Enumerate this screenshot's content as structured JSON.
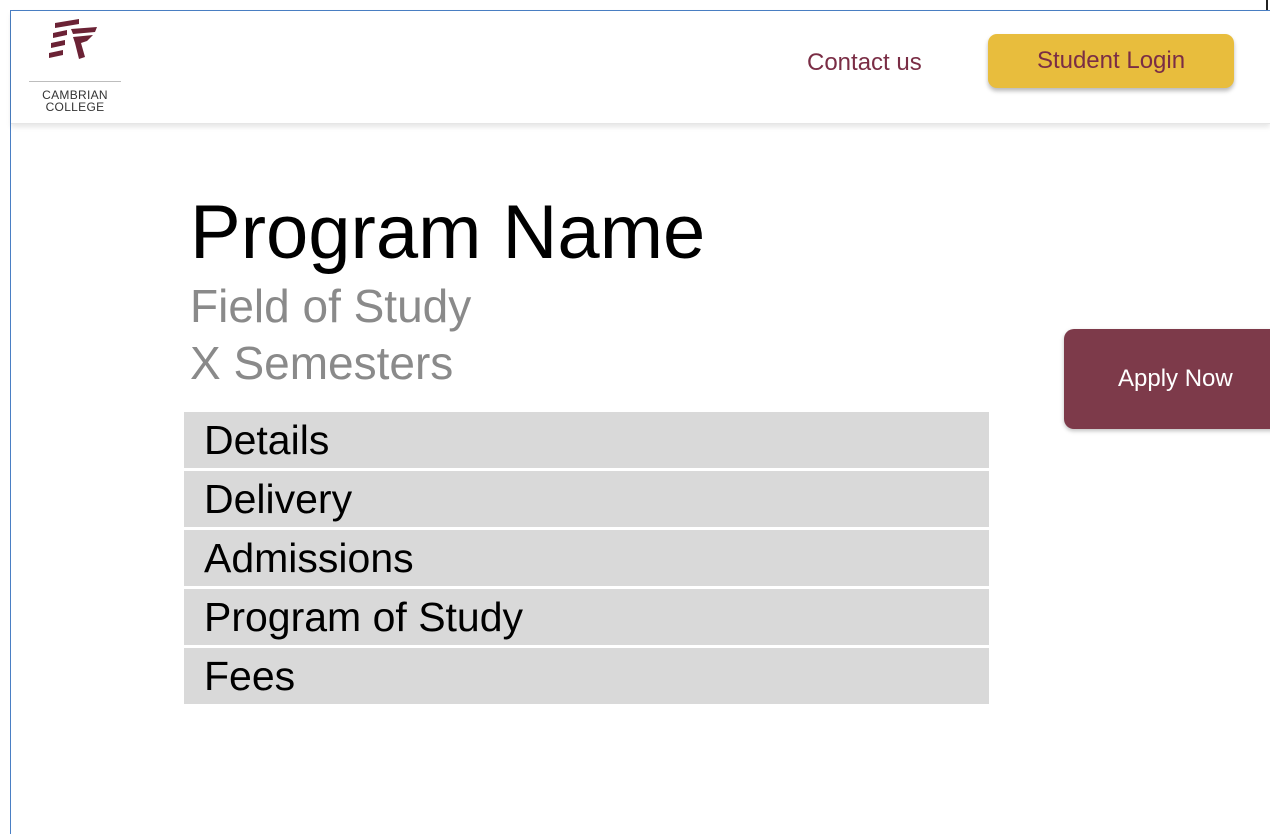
{
  "header": {
    "logo": {
      "icon": "cambrian-college-logo",
      "line1": "CAMBRIAN",
      "line2": "COLLEGE"
    },
    "contact_label": "Contact us",
    "login_label": "Student Login"
  },
  "program": {
    "name": "Program Name",
    "field": "Field of Study",
    "semesters": "X Semesters"
  },
  "sections": [
    {
      "label": "Details"
    },
    {
      "label": "Delivery"
    },
    {
      "label": "Admissions"
    },
    {
      "label": "Program of Study"
    },
    {
      "label": "Fees"
    }
  ],
  "apply_label": "Apply Now",
  "colors": {
    "brand_maroon": "#7d3a4a",
    "accent_gold": "#e8bd3d",
    "link_color": "#7a2d45",
    "section_bg": "#d9d9d9",
    "subtitle_gray": "#8a8a8a"
  }
}
